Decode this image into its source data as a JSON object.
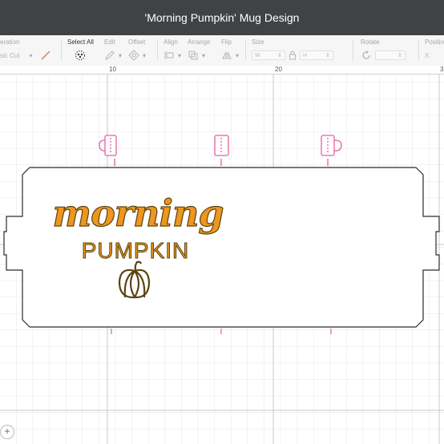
{
  "window": {
    "title": "'Morning Pumpkin' Mug Design"
  },
  "toolbar": {
    "operation_label": "eration",
    "operation_value": "sic Cut",
    "select_all_label": "Select All",
    "edit_label": "Edit",
    "offset_label": "Offset",
    "align_label": "Align",
    "arrange_label": "Arrange",
    "flip_label": "Flip",
    "size_label": "Size",
    "size_w": "W",
    "size_h": "H",
    "rotate_label": "Rotate",
    "position_label": "Positio",
    "position_x": "X"
  },
  "ruler": {
    "ticks": [
      "10",
      "20",
      "3"
    ]
  },
  "design": {
    "line1": "morning",
    "line2": "PUMPKIN",
    "text_color": "#ee961f",
    "outline_color": "#5a4410",
    "mug_icon_color": "#e3609f"
  }
}
